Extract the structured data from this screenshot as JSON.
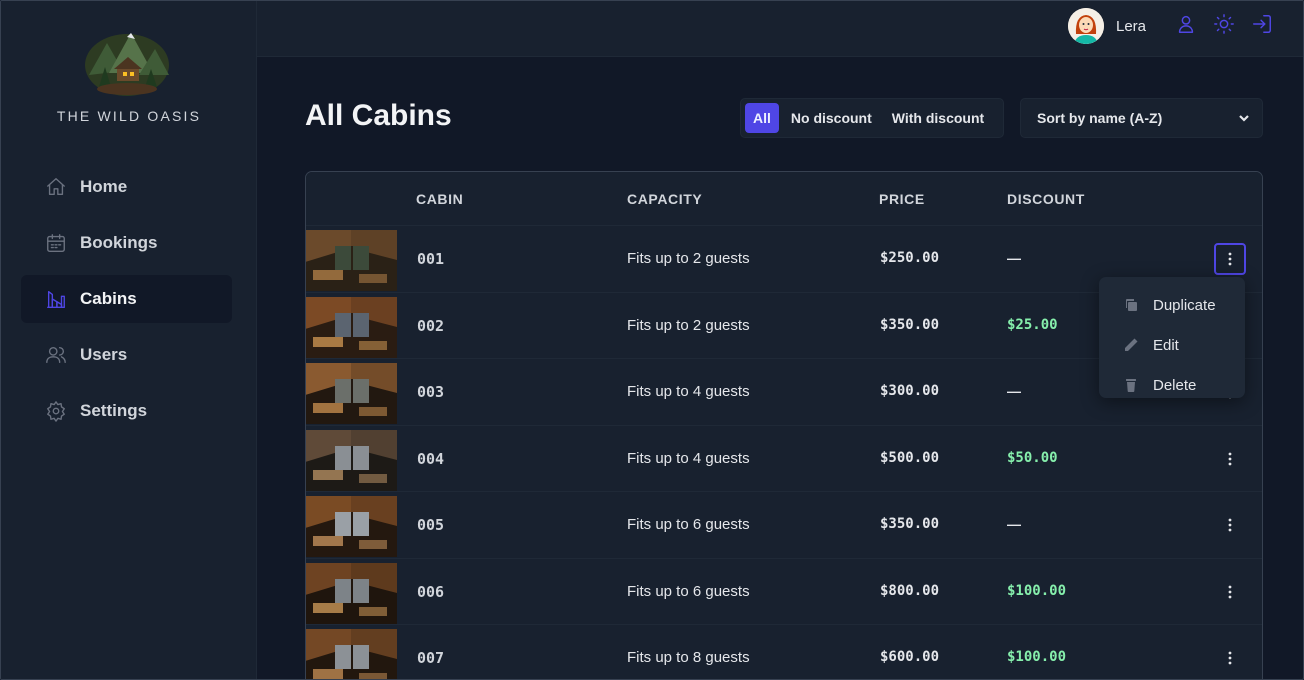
{
  "sidebar": {
    "brand": "THE WILD OASIS",
    "items": [
      {
        "label": "Home",
        "icon": "home-icon"
      },
      {
        "label": "Bookings",
        "icon": "calendar-icon"
      },
      {
        "label": "Cabins",
        "icon": "cabin-icon",
        "active": true
      },
      {
        "label": "Users",
        "icon": "users-icon"
      },
      {
        "label": "Settings",
        "icon": "gear-icon"
      }
    ]
  },
  "header": {
    "user_name": "Lera",
    "icons": [
      "user-icon",
      "sun-icon",
      "logout-icon"
    ]
  },
  "main": {
    "title": "All Cabins",
    "filters": [
      "All",
      "No discount",
      "With discount"
    ],
    "active_filter": "All",
    "sort_value": "Sort by name (A-Z)",
    "columns": [
      "CABIN",
      "CAPACITY",
      "PRICE",
      "DISCOUNT"
    ],
    "rows": [
      {
        "cabin": "001",
        "capacity": "Fits up to 2 guests",
        "price": "$250.00",
        "discount": "—"
      },
      {
        "cabin": "002",
        "capacity": "Fits up to 2 guests",
        "price": "$350.00",
        "discount": "$25.00"
      },
      {
        "cabin": "003",
        "capacity": "Fits up to 4 guests",
        "price": "$300.00",
        "discount": "—"
      },
      {
        "cabin": "004",
        "capacity": "Fits up to 4 guests",
        "price": "$500.00",
        "discount": "$50.00"
      },
      {
        "cabin": "005",
        "capacity": "Fits up to 6 guests",
        "price": "$350.00",
        "discount": "—"
      },
      {
        "cabin": "006",
        "capacity": "Fits up to 6 guests",
        "price": "$800.00",
        "discount": "$100.00"
      },
      {
        "cabin": "007",
        "capacity": "Fits up to 8 guests",
        "price": "$600.00",
        "discount": "$100.00"
      }
    ],
    "context_menu": [
      "Duplicate",
      "Edit",
      "Delete"
    ]
  },
  "colors": {
    "accent": "#4f46e5",
    "discount": "#86efac",
    "background": "#111827",
    "panel": "#18212f"
  }
}
